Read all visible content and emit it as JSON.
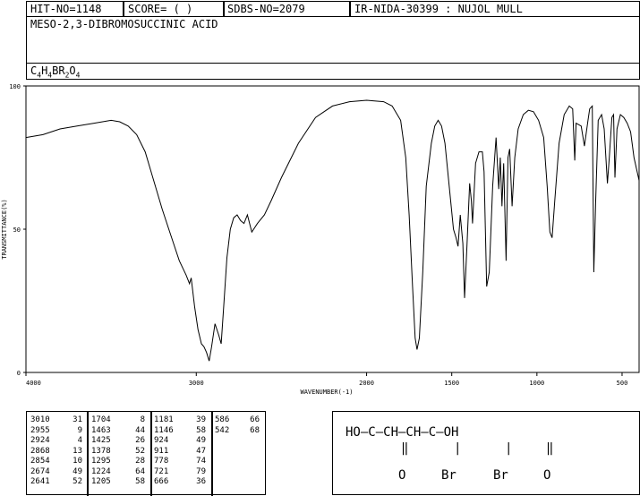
{
  "header": {
    "hit_no": "HIT-NO=1148",
    "score": "SCORE=  (   )",
    "sdbs_no": "SDBS-NO=2079",
    "ir_nida": "IR-NIDA-30399 : NUJOL MULL",
    "compound_name": "MESO-2,3-DIBROMOSUCCINIC ACID",
    "formula": {
      "c": "C",
      "c_n": "4",
      "h": "H",
      "h_n": "4",
      "br": "BR",
      "br_n": "2",
      "o": "O",
      "o_n": "4"
    }
  },
  "chart_data": {
    "type": "line",
    "xlabel": "WAVENUMBER(-1)",
    "ylabel": "TRANSMITTANCE(%)",
    "xlim": [
      4000,
      400
    ],
    "ylim": [
      0,
      100
    ],
    "x_ticks": [
      {
        "value": 4000,
        "label": "4000"
      },
      {
        "value": 3000,
        "label": "3000"
      },
      {
        "value": 2000,
        "label": "2000"
      },
      {
        "value": 1500,
        "label": "1500"
      },
      {
        "value": 1000,
        "label": "1000"
      },
      {
        "value": 500,
        "label": "500"
      }
    ],
    "y_ticks": [
      {
        "value": 0,
        "label": "0"
      },
      {
        "value": 50,
        "label": "50"
      },
      {
        "value": 100,
        "label": "100"
      }
    ],
    "series": [
      {
        "points": [
          [
            4000,
            82
          ],
          [
            3900,
            83
          ],
          [
            3800,
            85
          ],
          [
            3700,
            86
          ],
          [
            3600,
            87
          ],
          [
            3500,
            88
          ],
          [
            3450,
            87.5
          ],
          [
            3400,
            86
          ],
          [
            3350,
            83
          ],
          [
            3300,
            77
          ],
          [
            3250,
            67
          ],
          [
            3200,
            57
          ],
          [
            3150,
            48
          ],
          [
            3100,
            39
          ],
          [
            3060,
            34
          ],
          [
            3040,
            31
          ],
          [
            3030,
            33
          ],
          [
            3010,
            23
          ],
          [
            2990,
            15
          ],
          [
            2970,
            10
          ],
          [
            2955,
            9
          ],
          [
            2940,
            7
          ],
          [
            2924,
            4
          ],
          [
            2910,
            9
          ],
          [
            2890,
            17
          ],
          [
            2868,
            13
          ],
          [
            2854,
            10
          ],
          [
            2840,
            22
          ],
          [
            2820,
            40
          ],
          [
            2800,
            50
          ],
          [
            2780,
            54
          ],
          [
            2760,
            55
          ],
          [
            2740,
            53
          ],
          [
            2720,
            52
          ],
          [
            2700,
            55
          ],
          [
            2674,
            49
          ],
          [
            2641,
            52
          ],
          [
            2600,
            55
          ],
          [
            2560,
            60
          ],
          [
            2500,
            68
          ],
          [
            2400,
            80
          ],
          [
            2300,
            89
          ],
          [
            2200,
            93
          ],
          [
            2100,
            94.5
          ],
          [
            2000,
            95
          ],
          [
            1900,
            94.5
          ],
          [
            1850,
            93
          ],
          [
            1800,
            88
          ],
          [
            1770,
            75
          ],
          [
            1750,
            55
          ],
          [
            1730,
            30
          ],
          [
            1715,
            12
          ],
          [
            1704,
            8
          ],
          [
            1690,
            12
          ],
          [
            1670,
            35
          ],
          [
            1650,
            65
          ],
          [
            1620,
            80
          ],
          [
            1600,
            86
          ],
          [
            1580,
            88
          ],
          [
            1560,
            86
          ],
          [
            1540,
            80
          ],
          [
            1510,
            62
          ],
          [
            1490,
            50
          ],
          [
            1475,
            47
          ],
          [
            1463,
            44
          ],
          [
            1450,
            55
          ],
          [
            1435,
            45
          ],
          [
            1425,
            26
          ],
          [
            1410,
            45
          ],
          [
            1395,
            66
          ],
          [
            1385,
            60
          ],
          [
            1378,
            52
          ],
          [
            1360,
            73
          ],
          [
            1340,
            77
          ],
          [
            1320,
            77
          ],
          [
            1310,
            70
          ],
          [
            1295,
            30
          ],
          [
            1280,
            35
          ],
          [
            1260,
            65
          ],
          [
            1240,
            82
          ],
          [
            1224,
            64
          ],
          [
            1215,
            75
          ],
          [
            1205,
            58
          ],
          [
            1195,
            73
          ],
          [
            1181,
            39
          ],
          [
            1170,
            75
          ],
          [
            1160,
            78
          ],
          [
            1146,
            58
          ],
          [
            1130,
            75
          ],
          [
            1110,
            85
          ],
          [
            1080,
            90
          ],
          [
            1050,
            91.5
          ],
          [
            1020,
            91
          ],
          [
            990,
            88
          ],
          [
            960,
            82
          ],
          [
            940,
            65
          ],
          [
            924,
            49
          ],
          [
            911,
            47
          ],
          [
            895,
            60
          ],
          [
            870,
            80
          ],
          [
            840,
            90
          ],
          [
            810,
            93
          ],
          [
            790,
            92
          ],
          [
            778,
            74
          ],
          [
            770,
            87
          ],
          [
            740,
            86
          ],
          [
            721,
            79
          ],
          [
            700,
            88
          ],
          [
            690,
            92
          ],
          [
            675,
            93
          ],
          [
            666,
            35
          ],
          [
            655,
            60
          ],
          [
            640,
            88
          ],
          [
            620,
            90
          ],
          [
            605,
            85
          ],
          [
            586,
            66
          ],
          [
            575,
            75
          ],
          [
            560,
            89
          ],
          [
            550,
            90
          ],
          [
            542,
            68
          ],
          [
            530,
            85
          ],
          [
            510,
            90
          ],
          [
            490,
            89
          ],
          [
            470,
            87
          ],
          [
            450,
            84
          ],
          [
            430,
            75
          ],
          [
            400,
            67
          ]
        ]
      }
    ],
    "peak_table": [
      [
        [
          "3010",
          "31"
        ],
        [
          "2955",
          "9"
        ],
        [
          "2924",
          "4"
        ],
        [
          "2868",
          "13"
        ],
        [
          "2854",
          "10"
        ],
        [
          "2674",
          "49"
        ],
        [
          "2641",
          "52"
        ]
      ],
      [
        [
          "1704",
          "8"
        ],
        [
          "1463",
          "44"
        ],
        [
          "1425",
          "26"
        ],
        [
          "1378",
          "52"
        ],
        [
          "1295",
          "28"
        ],
        [
          "1224",
          "64"
        ],
        [
          "1205",
          "58"
        ]
      ],
      [
        [
          "1181",
          "39"
        ],
        [
          "1146",
          "58"
        ],
        [
          "924",
          "49"
        ],
        [
          "911",
          "47"
        ],
        [
          "778",
          "74"
        ],
        [
          "721",
          "79"
        ],
        [
          "666",
          "36"
        ]
      ],
      [
        [
          "586",
          "66"
        ],
        [
          "542",
          "68"
        ]
      ]
    ]
  },
  "structure": {
    "line1": "HO—C—CH—CH—C—OH",
    "o1": "O",
    "br1": "Br",
    "br2": "Br",
    "o2": "O"
  }
}
